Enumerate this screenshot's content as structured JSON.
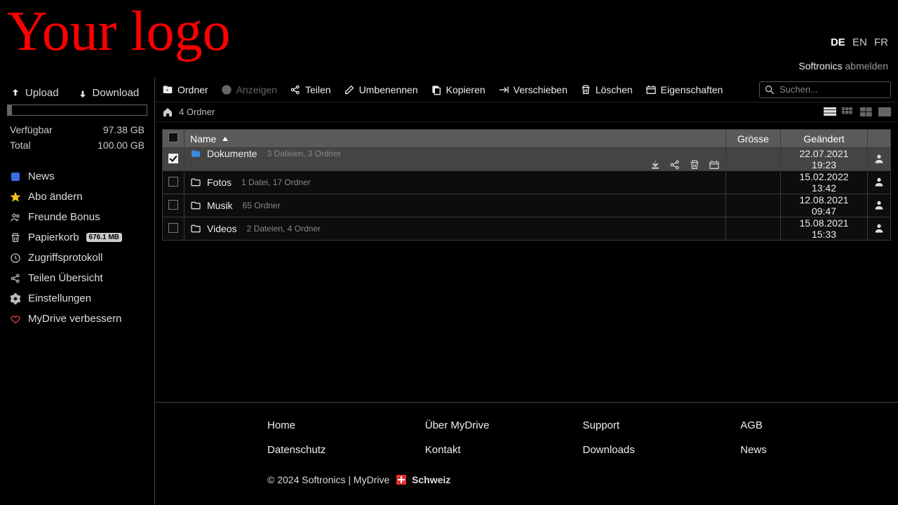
{
  "header": {
    "logo_text": "Your logo",
    "languages": [
      "DE",
      "EN",
      "FR"
    ],
    "active_language": "DE",
    "username": "Softronics",
    "logout_label": "abmelden"
  },
  "sidebar": {
    "upload_label": "Upload",
    "download_label": "Download",
    "storage": {
      "available_label": "Verfügbar",
      "available_value": "97.38 GB",
      "total_label": "Total",
      "total_value": "100.00 GB",
      "used_percent": 3
    },
    "items": [
      {
        "icon": "news-icon",
        "label": "News",
        "color": "c-blue",
        "badge": null
      },
      {
        "icon": "star-icon",
        "label": "Abo ändern",
        "color": "c-yellow",
        "badge": null
      },
      {
        "icon": "users-icon",
        "label": "Freunde Bonus",
        "color": "c-grey",
        "badge": null
      },
      {
        "icon": "trash-icon",
        "label": "Papierkorb",
        "color": "c-grey",
        "badge": "676.1 MB"
      },
      {
        "icon": "clock-icon",
        "label": "Zugriffsprotokoll",
        "color": "c-grey",
        "badge": null
      },
      {
        "icon": "share-icon",
        "label": "Teilen Übersicht",
        "color": "c-grey",
        "badge": null
      },
      {
        "icon": "gear-icon",
        "label": "Einstellungen",
        "color": "c-grey-fill",
        "badge": null
      },
      {
        "icon": "heart-icon",
        "label": "MyDrive verbessern",
        "color": "c-red",
        "badge": null
      }
    ]
  },
  "toolbar": {
    "buttons": [
      {
        "icon": "folder-plus-icon",
        "label": "Ordner",
        "disabled": false
      },
      {
        "icon": "play-icon",
        "label": "Anzeigen",
        "disabled": true
      },
      {
        "icon": "share-icon",
        "label": "Teilen",
        "disabled": false
      },
      {
        "icon": "rename-icon",
        "label": "Umbenennen",
        "disabled": false
      },
      {
        "icon": "copy-icon",
        "label": "Kopieren",
        "disabled": false
      },
      {
        "icon": "move-icon",
        "label": "Verschieben",
        "disabled": false
      },
      {
        "icon": "trash-icon",
        "label": "Löschen",
        "disabled": false
      },
      {
        "icon": "props-icon",
        "label": "Eigenschaften",
        "disabled": false
      }
    ],
    "search_placeholder": "Suchen..."
  },
  "breadcrumb": {
    "summary": "4 Ordner"
  },
  "table": {
    "columns": {
      "name": "Name",
      "size": "Grösse",
      "modified": "Geändert"
    },
    "sort_column": "name",
    "sort_dir": "asc",
    "rows": [
      {
        "selected": true,
        "icon_color": "#3a8de0",
        "name": "Dokumente",
        "meta": "3 Dateien, 3 Ordner",
        "size": "",
        "modified": "22.07.2021 19:23"
      },
      {
        "selected": false,
        "icon_color": "#ddd",
        "name": "Fotos",
        "meta": "1 Datei, 17 Ordner",
        "size": "",
        "modified": "15.02.2022 13:42"
      },
      {
        "selected": false,
        "icon_color": "#ddd",
        "name": "Musik",
        "meta": "65 Ordner",
        "size": "",
        "modified": "12.08.2021 09:47"
      },
      {
        "selected": false,
        "icon_color": "#ddd",
        "name": "Videos",
        "meta": "2 Dateien, 4 Ordner",
        "size": "",
        "modified": "15.08.2021 15:33"
      }
    ]
  },
  "footer": {
    "links": [
      "Home",
      "Über MyDrive",
      "Support",
      "AGB",
      "Datenschutz",
      "Kontakt",
      "Downloads",
      "News"
    ],
    "copyright_prefix": "© 2024 Softronics | MyDrive",
    "country": "Schweiz"
  }
}
